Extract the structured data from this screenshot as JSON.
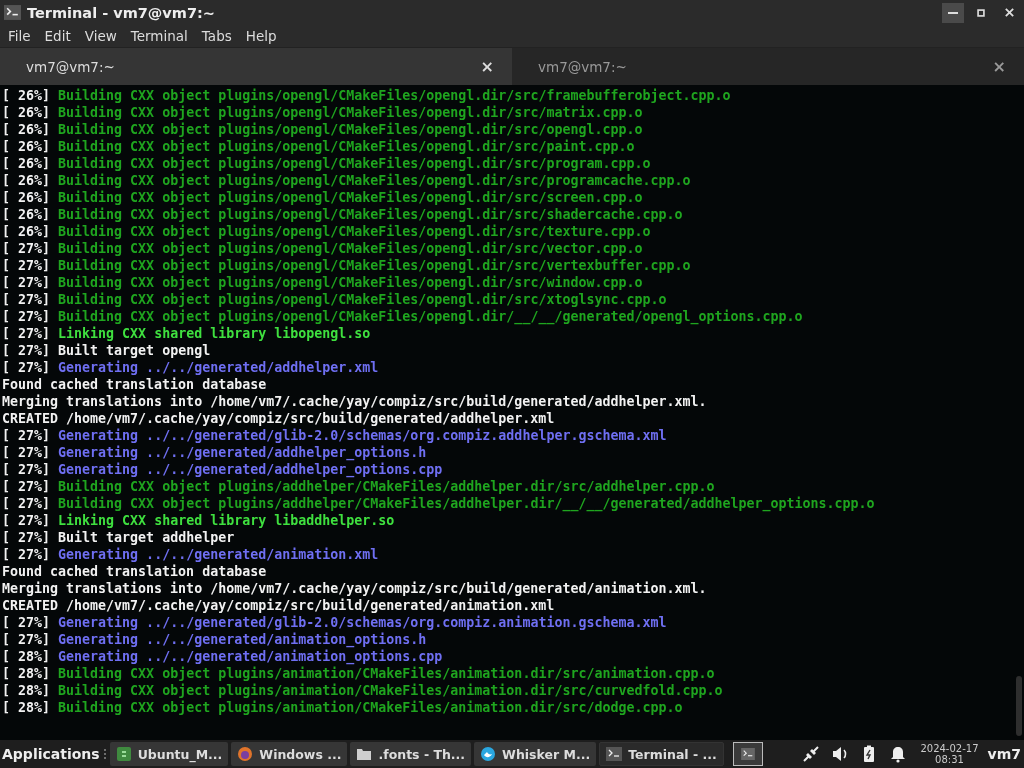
{
  "window": {
    "title": "Terminal - vm7@vm7:~"
  },
  "menu": [
    "File",
    "Edit",
    "View",
    "Terminal",
    "Tabs",
    "Help"
  ],
  "tabs": [
    {
      "label": "vm7@vm7:~",
      "selected": true,
      "close": "×"
    },
    {
      "label": "vm7@vm7:~",
      "selected": false,
      "close": "×"
    }
  ],
  "terminal": {
    "lines": [
      {
        "progress": "[ 26%]",
        "kind": "build",
        "text": "Building CXX object plugins/opengl/CMakeFiles/opengl.dir/src/framebufferobject.cpp.o"
      },
      {
        "progress": "[ 26%]",
        "kind": "build",
        "text": "Building CXX object plugins/opengl/CMakeFiles/opengl.dir/src/matrix.cpp.o"
      },
      {
        "progress": "[ 26%]",
        "kind": "build",
        "text": "Building CXX object plugins/opengl/CMakeFiles/opengl.dir/src/opengl.cpp.o"
      },
      {
        "progress": "[ 26%]",
        "kind": "build",
        "text": "Building CXX object plugins/opengl/CMakeFiles/opengl.dir/src/paint.cpp.o"
      },
      {
        "progress": "[ 26%]",
        "kind": "build",
        "text": "Building CXX object plugins/opengl/CMakeFiles/opengl.dir/src/program.cpp.o"
      },
      {
        "progress": "[ 26%]",
        "kind": "build",
        "text": "Building CXX object plugins/opengl/CMakeFiles/opengl.dir/src/programcache.cpp.o"
      },
      {
        "progress": "[ 26%]",
        "kind": "build",
        "text": "Building CXX object plugins/opengl/CMakeFiles/opengl.dir/src/screen.cpp.o"
      },
      {
        "progress": "[ 26%]",
        "kind": "build",
        "text": "Building CXX object plugins/opengl/CMakeFiles/opengl.dir/src/shadercache.cpp.o"
      },
      {
        "progress": "[ 26%]",
        "kind": "build",
        "text": "Building CXX object plugins/opengl/CMakeFiles/opengl.dir/src/texture.cpp.o"
      },
      {
        "progress": "[ 27%]",
        "kind": "build",
        "text": "Building CXX object plugins/opengl/CMakeFiles/opengl.dir/src/vector.cpp.o"
      },
      {
        "progress": "[ 27%]",
        "kind": "build",
        "text": "Building CXX object plugins/opengl/CMakeFiles/opengl.dir/src/vertexbuffer.cpp.o"
      },
      {
        "progress": "[ 27%]",
        "kind": "build",
        "text": "Building CXX object plugins/opengl/CMakeFiles/opengl.dir/src/window.cpp.o"
      },
      {
        "progress": "[ 27%]",
        "kind": "build",
        "text": "Building CXX object plugins/opengl/CMakeFiles/opengl.dir/src/xtoglsync.cpp.o"
      },
      {
        "progress": "[ 27%]",
        "kind": "build",
        "text": "Building CXX object plugins/opengl/CMakeFiles/opengl.dir/__/__/generated/opengl_options.cpp.o"
      },
      {
        "progress": "[ 27%]",
        "kind": "link",
        "text": "Linking CXX shared library libopengl.so"
      },
      {
        "progress": "[ 27%]",
        "kind": "plain",
        "text": "Built target opengl"
      },
      {
        "progress": "[ 27%]",
        "kind": "generate",
        "text": "Generating ../../generated/addhelper.xml"
      },
      {
        "kind": "plain",
        "text": "Found cached translation database"
      },
      {
        "kind": "plain",
        "text": "Merging translations into /home/vm7/.cache/yay/compiz/src/build/generated/addhelper.xml."
      },
      {
        "kind": "plain",
        "text": "CREATED /home/vm7/.cache/yay/compiz/src/build/generated/addhelper.xml"
      },
      {
        "progress": "[ 27%]",
        "kind": "generate",
        "text": "Generating ../../generated/glib-2.0/schemas/org.compiz.addhelper.gschema.xml"
      },
      {
        "progress": "[ 27%]",
        "kind": "generate",
        "text": "Generating ../../generated/addhelper_options.h"
      },
      {
        "progress": "[ 27%]",
        "kind": "generate",
        "text": "Generating ../../generated/addhelper_options.cpp"
      },
      {
        "progress": "[ 27%]",
        "kind": "build",
        "text": "Building CXX object plugins/addhelper/CMakeFiles/addhelper.dir/src/addhelper.cpp.o"
      },
      {
        "progress": "[ 27%]",
        "kind": "build",
        "text": "Building CXX object plugins/addhelper/CMakeFiles/addhelper.dir/__/__/generated/addhelper_options.cpp.o"
      },
      {
        "progress": "[ 27%]",
        "kind": "link",
        "text": "Linking CXX shared library libaddhelper.so"
      },
      {
        "progress": "[ 27%]",
        "kind": "plain",
        "text": "Built target addhelper"
      },
      {
        "progress": "[ 27%]",
        "kind": "generate",
        "text": "Generating ../../generated/animation.xml"
      },
      {
        "kind": "plain",
        "text": "Found cached translation database"
      },
      {
        "kind": "plain",
        "text": "Merging translations into /home/vm7/.cache/yay/compiz/src/build/generated/animation.xml."
      },
      {
        "kind": "plain",
        "text": "CREATED /home/vm7/.cache/yay/compiz/src/build/generated/animation.xml"
      },
      {
        "progress": "[ 27%]",
        "kind": "generate",
        "text": "Generating ../../generated/glib-2.0/schemas/org.compiz.animation.gschema.xml"
      },
      {
        "progress": "[ 27%]",
        "kind": "generate",
        "text": "Generating ../../generated/animation_options.h"
      },
      {
        "progress": "[ 28%]",
        "kind": "generate",
        "text": "Generating ../../generated/animation_options.cpp"
      },
      {
        "progress": "[ 28%]",
        "kind": "build",
        "text": "Building CXX object plugins/animation/CMakeFiles/animation.dir/src/animation.cpp.o"
      },
      {
        "progress": "[ 28%]",
        "kind": "build",
        "text": "Building CXX object plugins/animation/CMakeFiles/animation.dir/src/curvedfold.cpp.o"
      },
      {
        "progress": "[ 28%]",
        "kind": "build",
        "text": "Building CXX object plugins/animation/CMakeFiles/animation.dir/src/dodge.cpp.o"
      }
    ]
  },
  "taskbar": {
    "menu": "Applications",
    "tasks": [
      {
        "label": "Ubuntu_M...",
        "selected": false
      },
      {
        "label": "Windows ...",
        "selected": false
      },
      {
        "label": ".fonts - Th...",
        "selected": false
      },
      {
        "label": "Whisker M...",
        "selected": false
      },
      {
        "label": "Terminal - ...",
        "selected": true
      }
    ],
    "date": "2024-02-17",
    "time": "08:31",
    "user": "vm7"
  }
}
